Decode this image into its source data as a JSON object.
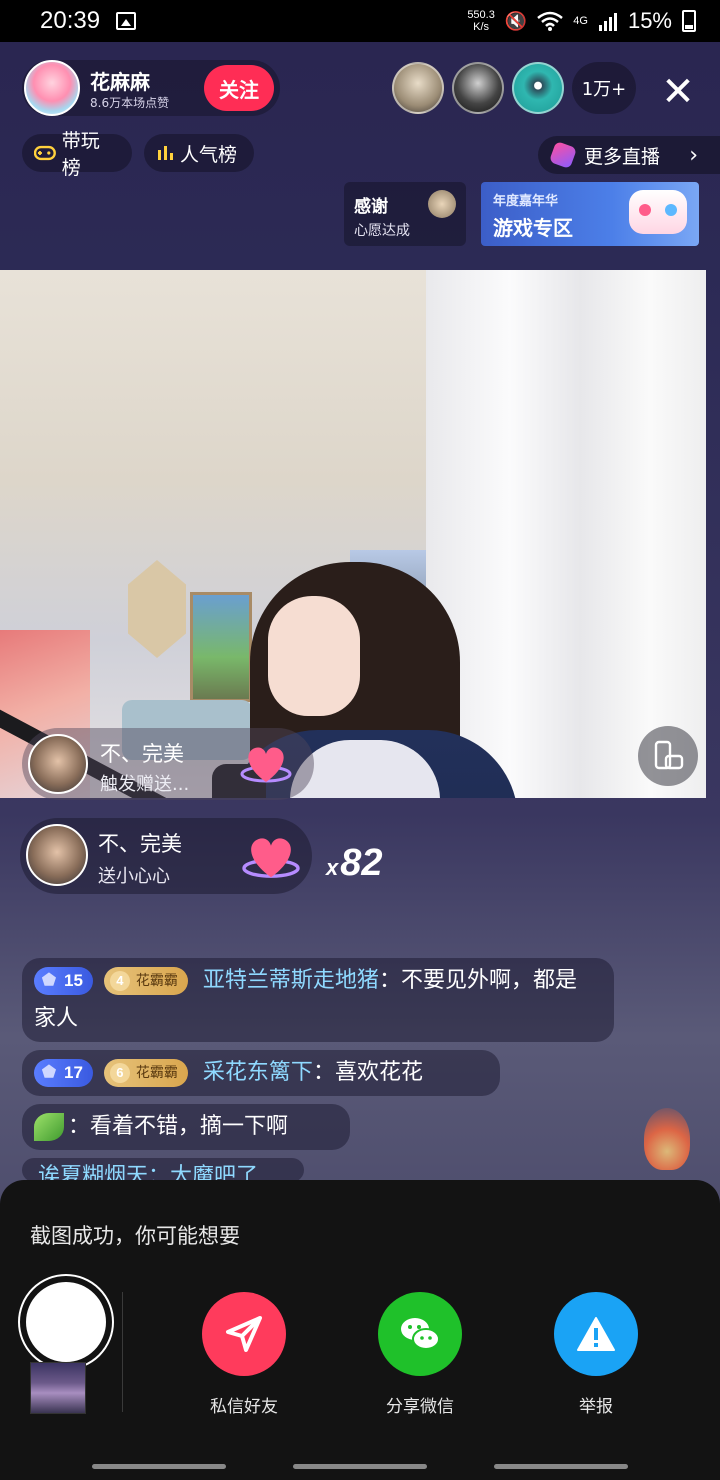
{
  "status_bar": {
    "time": "20:39",
    "net_speed_value": "550.3",
    "net_speed_unit": "K/s",
    "network": "4G",
    "battery": "15%",
    "icons": [
      "gallery-icon",
      "mute-icon",
      "wifi-icon",
      "signal-icon",
      "battery-icon"
    ]
  },
  "header": {
    "host_name": "花麻麻",
    "host_likes": "8.6万本场点赞",
    "follow_label": "关注",
    "viewer_count": "1万+",
    "close_label": "✕",
    "tabs": [
      {
        "label": "带玩榜",
        "icon": "gamepad-icon"
      },
      {
        "label": "人气榜",
        "icon": "bar-chart-icon"
      }
    ],
    "more_live_label": "更多直播"
  },
  "thanks_card": {
    "title": "感谢",
    "subtitle": "心愿达成"
  },
  "event_banner": {
    "line1": "年度嘉年华",
    "line2": "游戏专区"
  },
  "video_overlay": {
    "gift_user": "不、完美",
    "gift_text": "触发赠送..."
  },
  "gift_combo": {
    "user": "不、完美",
    "gift": "送小心心",
    "multiplier": "x",
    "count": "82"
  },
  "chat": [
    {
      "level": "15",
      "fan_level": "4",
      "fan_badge": "花霸霸",
      "user": "亚特兰蒂斯走地猪",
      "message": "：不要见外啊，都是家人"
    },
    {
      "level": "17",
      "fan_level": "6",
      "fan_badge": "花霸霸",
      "user": "采花东篱下",
      "message": "：喜欢花花"
    },
    {
      "message": "：看着不错，摘一下啊"
    },
    {
      "message": "诶夏糊烟天：大魔吧了"
    }
  ],
  "share_sheet": {
    "title": "截图成功，你可能想要",
    "actions": [
      {
        "label": "私信好友",
        "icon": "paper-plane-icon"
      },
      {
        "label": "分享微信",
        "icon": "wechat-icon"
      },
      {
        "label": "举报",
        "icon": "warning-icon"
      }
    ]
  },
  "colors": {
    "follow": "#ff2d55",
    "username": "#8fd9ff",
    "share_friend": "#ff3b5c",
    "share_wechat": "#1fc12a",
    "share_report": "#1aa3f5"
  }
}
